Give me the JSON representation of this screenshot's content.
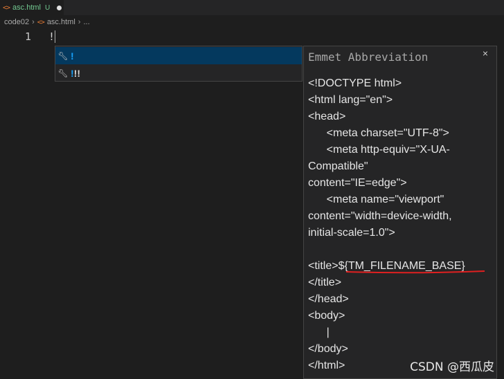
{
  "tab": {
    "icon": "html-file-icon",
    "filename": "asc.html",
    "status_badge": "U"
  },
  "breadcrumb": {
    "folder": "code02",
    "file": "asc.html",
    "ellipsis": "..."
  },
  "editor": {
    "line_number": "1",
    "line_text": "!"
  },
  "suggest": {
    "items": [
      {
        "icon": "wrench-icon",
        "label": "!"
      },
      {
        "icon": "wrench-icon",
        "label_match": "!",
        "label_rest": "!!"
      }
    ]
  },
  "details": {
    "title": "Emmet Abbreviation",
    "close": "×",
    "content": "<!DOCTYPE html>\n<html lang=\"en\">\n<head>\n      <meta charset=\"UTF-8\">\n      <meta http-equiv=\"X-UA-Compatible\"\ncontent=\"IE=edge\">\n      <meta name=\"viewport\"\ncontent=\"width=device-width,\ninitial-scale=1.0\">\n\n<title>${TM_FILENAME_BASE}\n</title>\n</head>\n<body>\n      |\n</body>\n</html>"
  },
  "watermark": "CSDN @西瓜皮",
  "colors": {
    "selection": "#04395e",
    "match_highlight": "#18a3ff",
    "annotation_underline": "#e02020"
  }
}
